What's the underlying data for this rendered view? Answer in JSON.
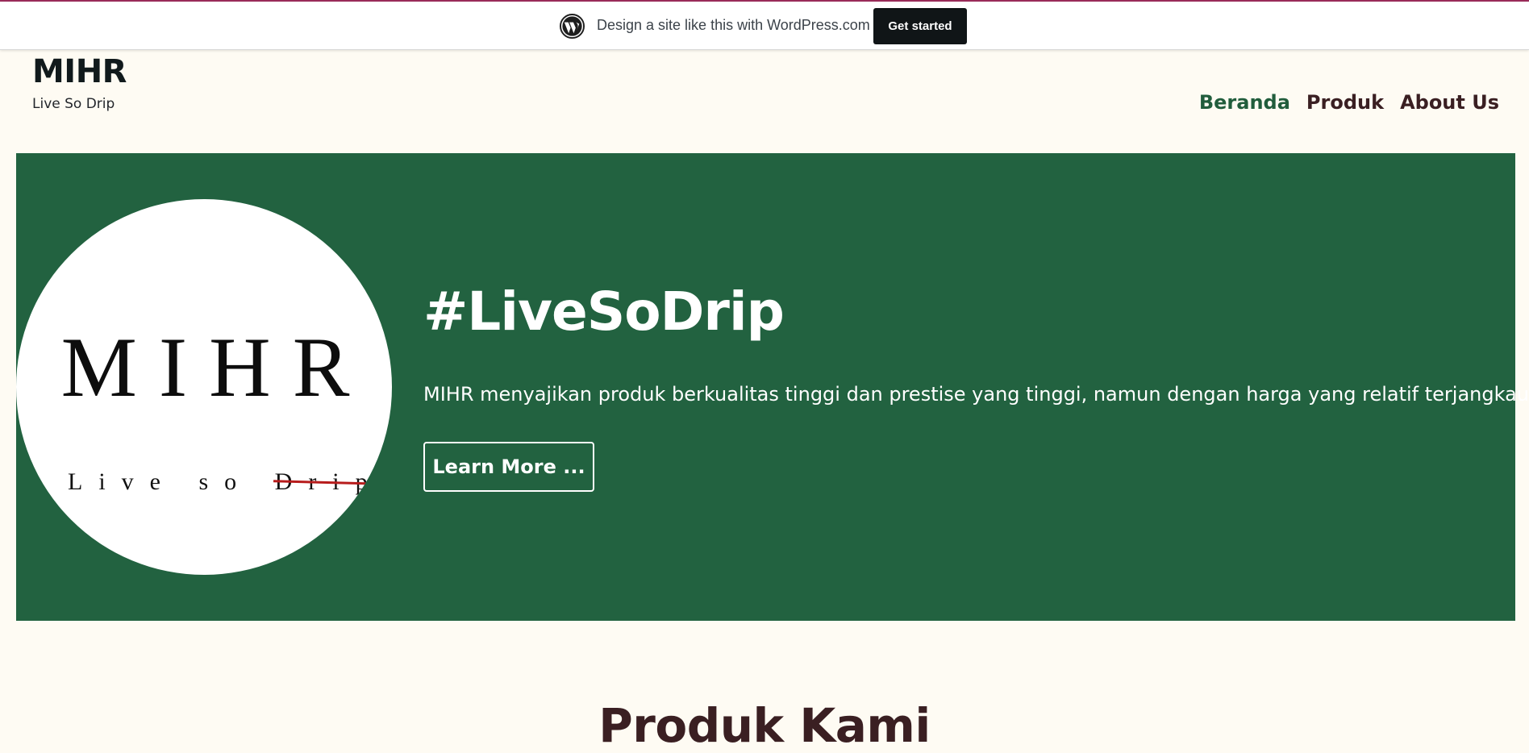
{
  "wp_bar": {
    "message": "Design a site like this with WordPress.com",
    "cta_label": "Get started",
    "icon": "wordpress-logo-icon"
  },
  "site": {
    "title": "MIHR",
    "tagline": "Live So Drip"
  },
  "nav": {
    "items": [
      {
        "label": "Beranda",
        "active": true
      },
      {
        "label": "Produk",
        "active": false
      },
      {
        "label": "About Us",
        "active": false
      }
    ]
  },
  "hero": {
    "logo_text": "MIHR",
    "logo_sub_prefix": "Live so",
    "logo_sub_struck": "Drip",
    "heading": "#LiveSoDrip",
    "text": "MIHR menyajikan produk berkualitas tinggi dan prestise yang tinggi, namun dengan harga yang relatif terjangkau.",
    "button_label": "Learn More ...",
    "background_color": "#226240"
  },
  "products_section": {
    "heading": "Produk Kami"
  },
  "colors": {
    "page_bg": "#fefbf3",
    "accent_green": "#215d3c",
    "heading_dark": "#3a1f22"
  }
}
